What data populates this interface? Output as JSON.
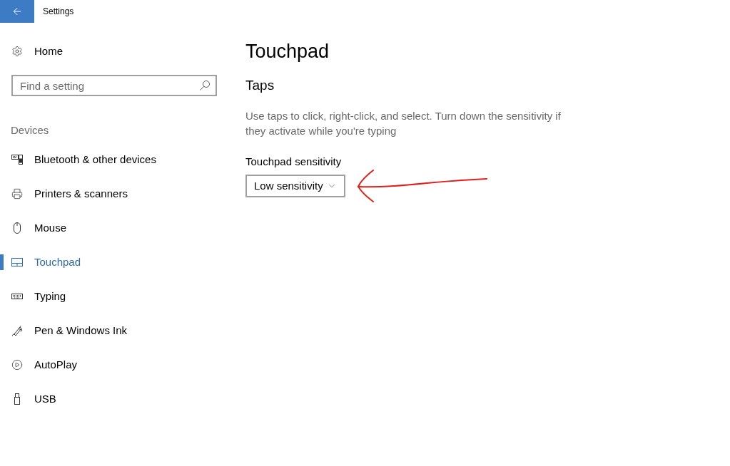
{
  "window": {
    "title": "Settings"
  },
  "sidebar": {
    "home": "Home",
    "search": {
      "placeholder": "Find a setting"
    },
    "section": "Devices",
    "items": [
      {
        "label": "Bluetooth & other devices",
        "selected": false
      },
      {
        "label": "Printers & scanners",
        "selected": false
      },
      {
        "label": "Mouse",
        "selected": false
      },
      {
        "label": "Touchpad",
        "selected": true
      },
      {
        "label": "Typing",
        "selected": false
      },
      {
        "label": "Pen & Windows Ink",
        "selected": false
      },
      {
        "label": "AutoPlay",
        "selected": false
      },
      {
        "label": "USB",
        "selected": false
      }
    ]
  },
  "page": {
    "title": "Touchpad",
    "section_title": "Taps",
    "description": "Use taps to click, right-click, and select. Turn down the sensitivity if they activate while you're typing",
    "setting_label": "Touchpad sensitivity",
    "dropdown": {
      "value": "Low sensitivity"
    }
  }
}
